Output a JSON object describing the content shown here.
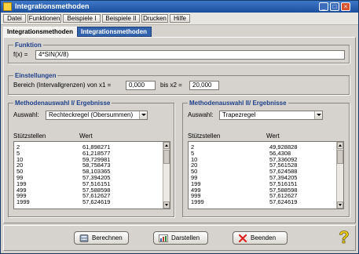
{
  "window": {
    "title": "Integrationsmethoden"
  },
  "menu": [
    "Datei",
    "Funktionen",
    "Beispiele I",
    "Beispiele II",
    "Drucken",
    "Hilfe"
  ],
  "tabs": [
    "Integrationsmethoden I",
    "Integrationsmethoden II"
  ],
  "funktion": {
    "group_title": "Funktion",
    "label": "f(x) =",
    "value": "4*SIN(X/8)"
  },
  "einstellungen": {
    "group_title": "Einstellungen",
    "label_x1": "Bereich (Intervallgrenzen) von x1 =",
    "x1": "0,000",
    "label_x2": "bis x2 =",
    "x2": "20,000"
  },
  "method1": {
    "group_title": "Methodenauswahl I/ Ergebnisse",
    "select_label": "Auswahl:",
    "selected": "Rechteckregel (Obersummen)",
    "col_a": "Stützstellen",
    "col_b": "Wert",
    "rows": [
      [
        "2",
        "61,898271"
      ],
      [
        "5",
        "61,218577"
      ],
      [
        "10",
        "59,729981"
      ],
      [
        "20",
        "58,758473"
      ],
      [
        "50",
        "58,103365"
      ],
      [
        "99",
        "57,394205"
      ],
      [
        "199",
        "57,516151"
      ],
      [
        "499",
        "57,588598"
      ],
      [
        "999",
        "57,612627"
      ],
      [
        "1999",
        "57,624619"
      ]
    ]
  },
  "method2": {
    "group_title": "Methodenauswahl II/ Ergebnisse",
    "select_label": "Auswahl:",
    "selected": "Trapezregel",
    "col_a": "Stützstellen",
    "col_b": "Wert",
    "rows": [
      [
        "2",
        "49,928828"
      ],
      [
        "5",
        "56,4308"
      ],
      [
        "10",
        "57,336092"
      ],
      [
        "20",
        "57,561528"
      ],
      [
        "50",
        "57,624588"
      ],
      [
        "99",
        "57,394205"
      ],
      [
        "199",
        "57,516151"
      ],
      [
        "499",
        "57,588598"
      ],
      [
        "999",
        "57,612627"
      ],
      [
        "1999",
        "57,624619"
      ]
    ]
  },
  "buttons": {
    "calculate": "Berechnen",
    "show": "Darstellen",
    "exit": "Beenden"
  },
  "icons": [
    "app-icon",
    "minimize-icon",
    "maximize-icon",
    "close-icon",
    "calculator-icon",
    "chart-icon",
    "exit-x-icon",
    "help-question-icon"
  ]
}
